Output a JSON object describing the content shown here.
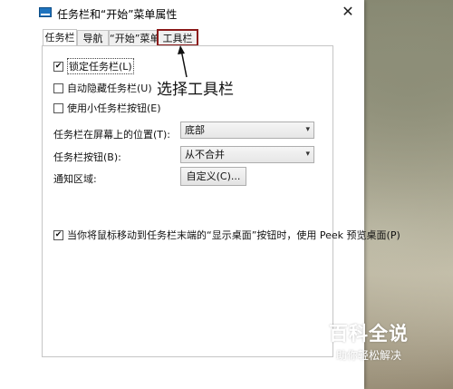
{
  "window": {
    "title": "任务栏和“开始”菜单属性",
    "close_glyph": "✕"
  },
  "tabs": [
    {
      "label": "任务栏",
      "active": true
    },
    {
      "label": "导航",
      "active": false
    },
    {
      "label": "“开始”菜单",
      "active": false
    },
    {
      "label": "工具栏",
      "active": false,
      "highlighted": true
    }
  ],
  "options": {
    "lock_taskbar": {
      "label": "锁定任务栏(L)",
      "checked": true
    },
    "auto_hide": {
      "label": "自动隐藏任务栏(U)",
      "checked": false
    },
    "small_buttons": {
      "label": "使用小任务栏按钮(E)",
      "checked": false
    },
    "peek": {
      "label": "当你将鼠标移动到任务栏末端的“显示桌面”按钮时，使用 Peek 预览桌面(P)",
      "checked": true
    }
  },
  "position": {
    "label": "任务栏在屏幕上的位置(T):",
    "value": "底部"
  },
  "buttons_combine": {
    "label": "任务栏按钮(B):",
    "value": "从不合并"
  },
  "notification": {
    "label": "通知区域:",
    "button": "自定义(C)..."
  },
  "annotation": {
    "text": "选择工具栏"
  },
  "watermark": {
    "logo": "百科全说",
    "subtitle": "助你轻松解决"
  }
}
